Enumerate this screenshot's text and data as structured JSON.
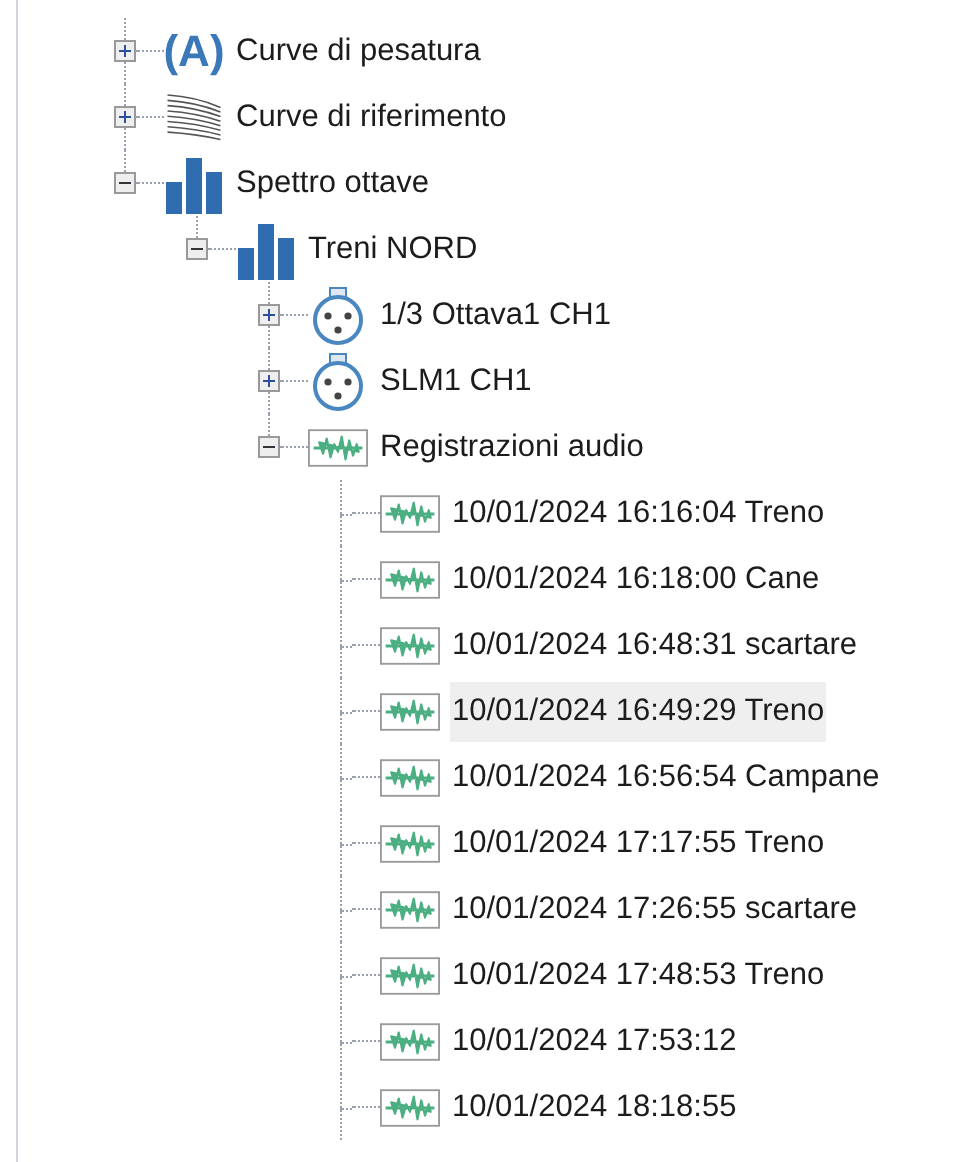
{
  "tree": [
    {
      "label": "Curve di pesatura",
      "kind": "weighting",
      "icon_text": "(A)",
      "expanded": false,
      "selected": false
    },
    {
      "label": "Curve di riferimento",
      "kind": "curves",
      "expanded": false,
      "selected": false
    },
    {
      "label": "Spettro ottave",
      "kind": "bars",
      "expanded": true,
      "selected": false,
      "children": [
        {
          "label": "Treni NORD",
          "kind": "bars",
          "expanded": true,
          "selected": false,
          "children": [
            {
              "label": "1/3 Ottava1 CH1",
              "kind": "connector",
              "expanded": false,
              "selected": false
            },
            {
              "label": "SLM1 CH1",
              "kind": "connector",
              "expanded": false,
              "selected": false
            },
            {
              "label": "Registrazioni audio",
              "kind": "wave",
              "expanded": true,
              "selected": false,
              "children": [
                {
                  "label": "10/01/2024 16:16:04 Treno",
                  "kind": "wave",
                  "selected": false
                },
                {
                  "label": "10/01/2024 16:18:00 Cane",
                  "kind": "wave",
                  "selected": false
                },
                {
                  "label": "10/01/2024 16:48:31 scartare",
                  "kind": "wave",
                  "selected": false
                },
                {
                  "label": "10/01/2024 16:49:29 Treno",
                  "kind": "wave",
                  "selected": true
                },
                {
                  "label": "10/01/2024 16:56:54 Campane",
                  "kind": "wave",
                  "selected": false
                },
                {
                  "label": "10/01/2024 17:17:55 Treno",
                  "kind": "wave",
                  "selected": false
                },
                {
                  "label": "10/01/2024 17:26:55 scartare",
                  "kind": "wave",
                  "selected": false
                },
                {
                  "label": "10/01/2024 17:48:53 Treno",
                  "kind": "wave",
                  "selected": false
                },
                {
                  "label": "10/01/2024 17:53:12",
                  "kind": "wave",
                  "selected": false
                },
                {
                  "label": "10/01/2024 18:18:55",
                  "kind": "wave",
                  "selected": false
                }
              ]
            }
          ]
        }
      ]
    }
  ]
}
